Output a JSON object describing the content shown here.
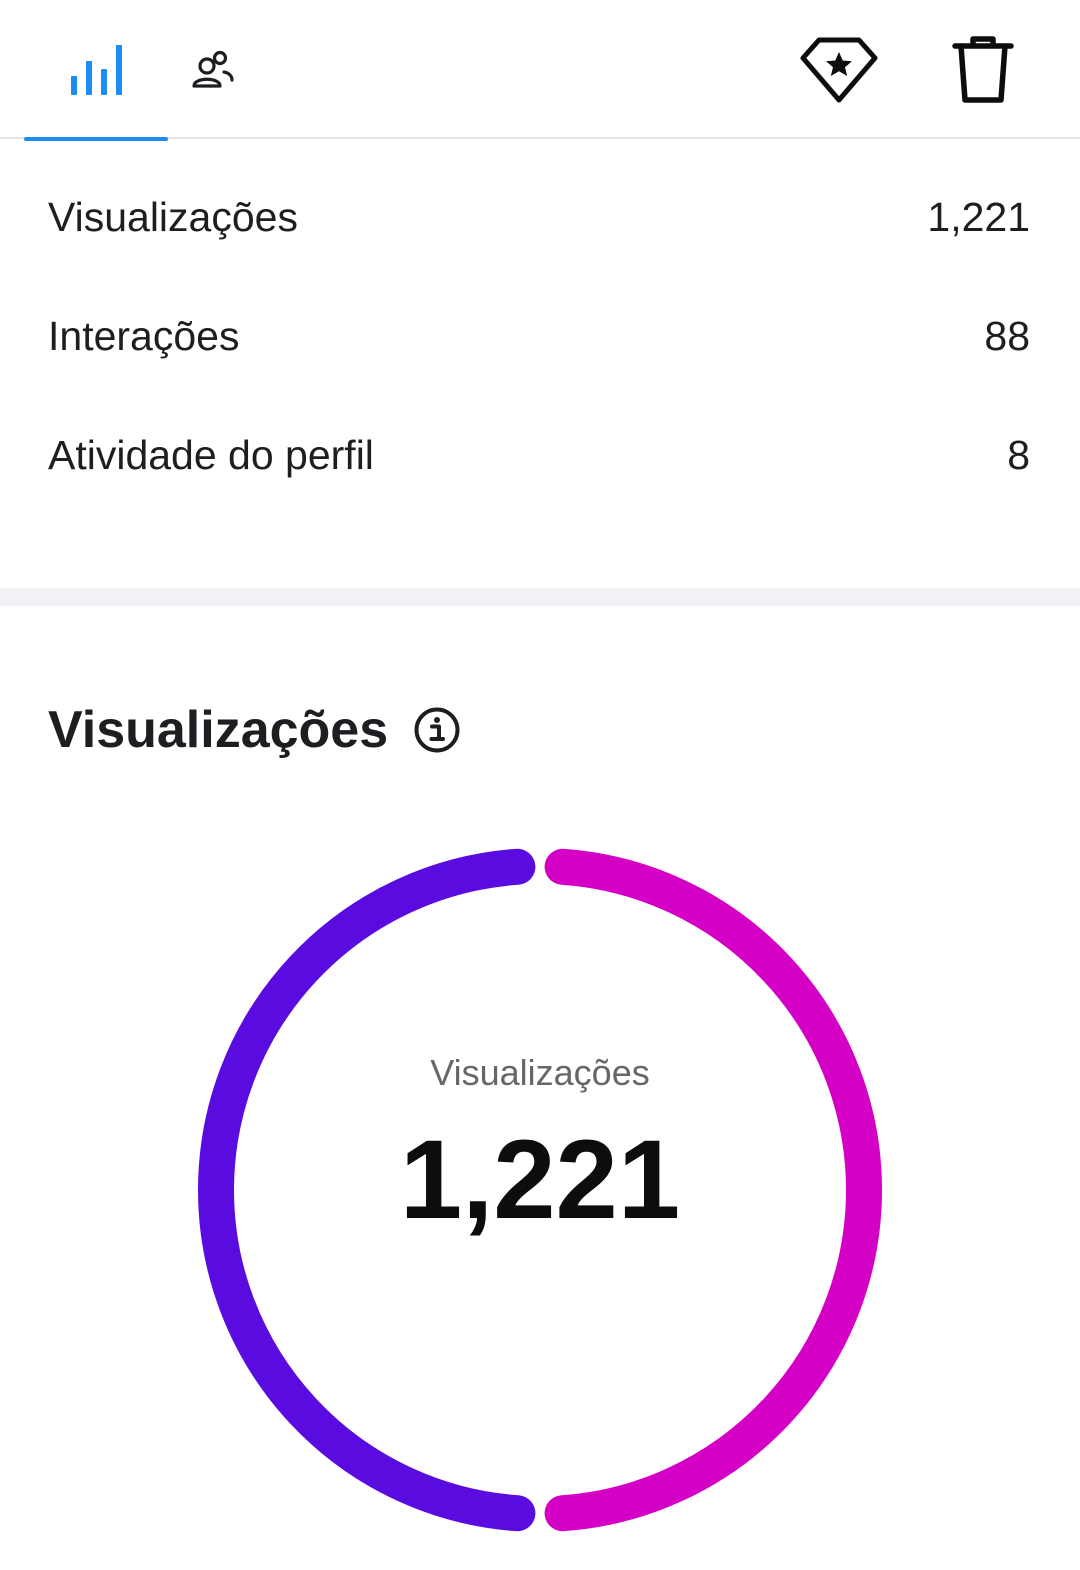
{
  "tabs": [
    {
      "icon": "bar-chart-icon",
      "active": true
    },
    {
      "icon": "audience-icon",
      "active": false
    }
  ],
  "actions": [
    {
      "icon": "boost-diamond-star-icon"
    },
    {
      "icon": "trash-icon"
    }
  ],
  "metrics": [
    {
      "label": "Visualizações",
      "value": "1,221"
    },
    {
      "label": "Interações",
      "value": "88"
    },
    {
      "label": "Atividade do perfil",
      "value": "8"
    }
  ],
  "views_section": {
    "title": "Visualizações",
    "info_icon": "info-icon"
  },
  "chart_data": {
    "type": "pie",
    "center_label": "Visualizações",
    "center_value": "1,221",
    "slices": [
      {
        "fraction": 0.5,
        "color": "#d500c6"
      },
      {
        "fraction": 0.5,
        "color": "#5a0be0"
      }
    ]
  },
  "colors": {
    "accent": "#1a8cf2",
    "tab_divider": "#e6e7ea",
    "section_divider": "#f0f2f5",
    "text": "#1c1e21",
    "muted": "#65676b"
  }
}
